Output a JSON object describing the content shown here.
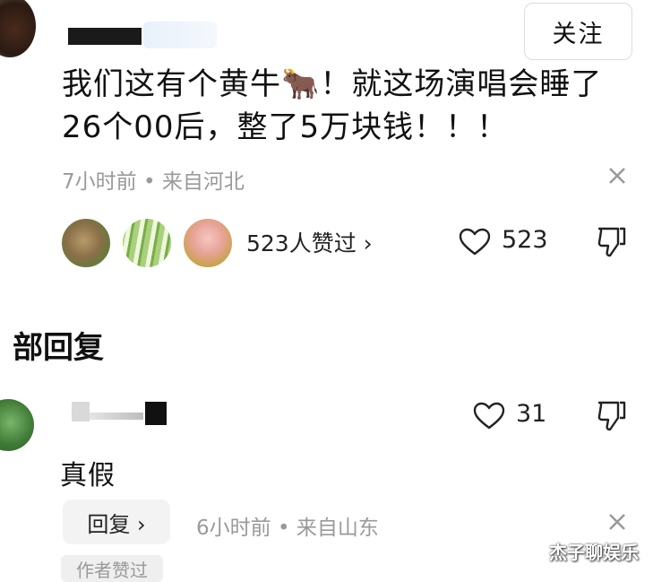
{
  "post": {
    "follow_label": "关注",
    "text_line1": "我们这有个黄牛🐂！就这场演唱会睡了",
    "text_line2": "26个00后，整了5万块钱！！！",
    "meta": "7小时前 • 来自河北",
    "likers_text": "523人赞过 ›",
    "like_count": "523",
    "icons": [
      "close-icon",
      "heart-icon",
      "thumb-down-icon"
    ]
  },
  "section": {
    "title": "部回复"
  },
  "reply": {
    "like_count": "31",
    "text": "真假",
    "reply_button": "回复 ›",
    "meta": "6小时前 • 来自山东",
    "author_tag": "作者赞过"
  },
  "watermark": "杰子聊娱乐",
  "colors": {
    "text": "#111111",
    "meta": "#9a9a9a",
    "button_bg": "#f3f3f3",
    "border": "#dcdcdc"
  }
}
